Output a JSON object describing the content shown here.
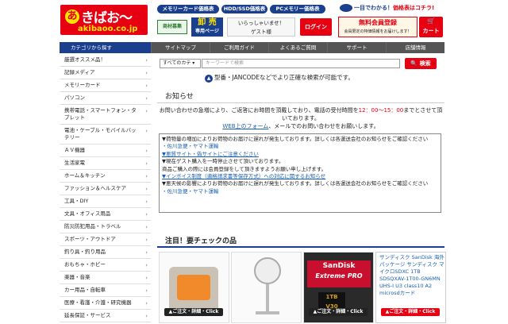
{
  "header": {
    "logo_main": "きばお～",
    "logo_mark": "あ",
    "logo_sub": "akibaoo.co.jp",
    "pills": [
      "メモリーカード価格表",
      "HDD/SSD価格表",
      "PCメモリー価格表"
    ],
    "badge_shozai": "商材募集",
    "badge_oroshi": "卸 売",
    "badge_oroshi_sub": "専用ページ",
    "welcome_line1": "いらっしゃいませ！",
    "welcome_line2": "ゲスト様",
    "login": "ログイン",
    "price_pre": "一目でわかる！",
    "price_hl": "価格表はコチラ!",
    "member_line1": "無料会員登録",
    "member_line2": "会員限定の特価情報をお届けします！",
    "cart_label": "カート"
  },
  "nav": {
    "category": "カテゴリから探す",
    "items": [
      "サイトマップ",
      "ご利用ガイド",
      "よくあるご質問",
      "サポート",
      "店舗情報"
    ]
  },
  "sidebar": {
    "items": [
      "厳選オススメ品！",
      "記録メディア",
      "メモリーカード",
      "パソコン",
      "携帯電話・スマートフォン・タブレット",
      "電池・ケーブル・モバイルバッテリー",
      "ＡＶ機器",
      "生活家電",
      "ホーム＆キッチン",
      "ファッション＆ヘルスケア",
      "工具・DIY",
      "文具・オフィス用品",
      "防災防犯用品・トラベル",
      "スポーツ・アウトドア",
      "釣り具・釣り用品",
      "おもちゃ・ホビー",
      "楽器・音楽",
      "カー用品・自転車",
      "医療・看護・介護・研究機器",
      "延長保証・サービス"
    ]
  },
  "search": {
    "category": "すべてのカテ",
    "placeholder": "キーワードで検索",
    "button": "検索",
    "hint": "型番・JANCODEなどでより正確な検索が可能です。"
  },
  "notice": {
    "title": "お知らせ",
    "line1_a": "お問い合わせの急増により、ご返答にお時間を頂戴しており、電話の受付時間を",
    "line1_red": "12：00～15：00",
    "line1_b": "までとさせて頂いております。",
    "line2_link": "WEB上のフォーム",
    "line2_b": "、メールでのお問い合わせをお願いします。",
    "box": [
      "▼荷物量の増加によりお荷物のお届けに遅れが発生しております。詳しくは各運送会社のお知らせをご確認ください",
      "・佐川急便・ヤマト運輸",
      "▼悪質サイト・偽サイトにご注意ください",
      "▼現在ゲスト購入を一時停止させて頂いております。",
      "商品ご購入の際には会員登録をして頂きますようお願い申し上げます。",
      "▼インボイス制度（適格請求書等保存方式）への対応に関するお知らせ",
      "▼悪天候の影響によりお荷物のお届けに遅れが発生しております。詳しくは各運送会社のお知らせをご確認ください",
      "・佐川急便・ヤマト運輸"
    ]
  },
  "featured": {
    "title": "注目！要チェックの品",
    "tag": "▲ご注文・詳細・Click",
    "tile4_text": "サンディスク SanDisk 海外パッケージ サンディスク マイクロSDXC 1TB SDSQXAV-1T00-GN6MN UHS-I U3 class10 A2 microsdカード",
    "sd_brand": "SanDisk",
    "sd_line": "Extreme PRO",
    "sd_cap": "1TB",
    "sd_cap2": "V30"
  },
  "colors": {
    "accent": "#e60012",
    "navy": "#1a3f8f",
    "link": "#1a5fb4"
  }
}
